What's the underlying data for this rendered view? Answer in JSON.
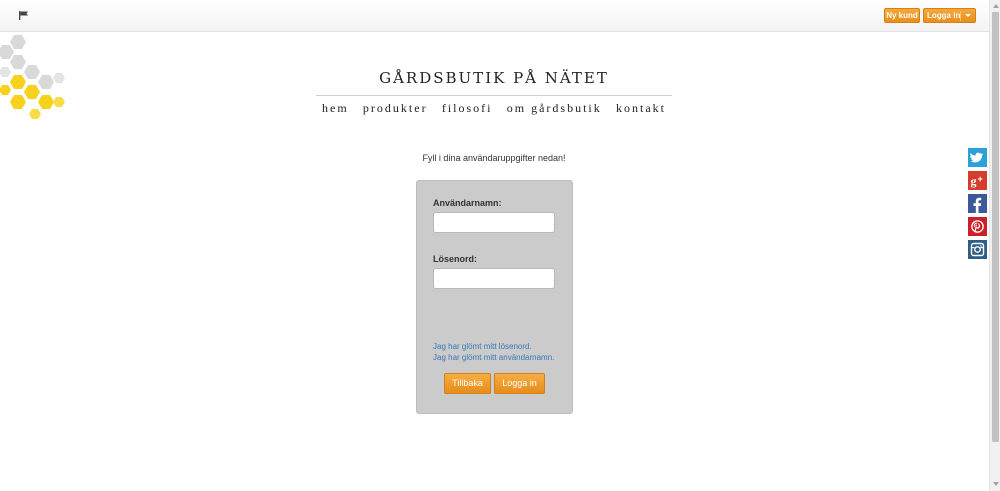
{
  "topbar": {
    "new_customer_label": "Ny kund",
    "login_label": "Logga in"
  },
  "site": {
    "title": "GÅRDSBUTIK PÅ NÄTET"
  },
  "nav": {
    "items": [
      {
        "label": "hem"
      },
      {
        "label": "produkter"
      },
      {
        "label": "filosofi"
      },
      {
        "label": "om gårdsbutik"
      },
      {
        "label": "kontakt"
      }
    ]
  },
  "login": {
    "intro": "Fyll i dina användaruppgifter nedan!",
    "username_label": "Användarnamn:",
    "username_value": "",
    "password_label": "Lösenord:",
    "password_value": "",
    "forgot_password": "Jag har glömt mitt lösenord.",
    "forgot_username": "Jag har glömt mitt användarnamn.",
    "back_button": "Tillbaka",
    "login_button": "Logga in"
  },
  "social": [
    {
      "icon": "twitter-icon",
      "color": "#2d9fd9"
    },
    {
      "icon": "google-plus-icon",
      "color": "#d23e2b"
    },
    {
      "icon": "facebook-icon",
      "color": "#3b5998"
    },
    {
      "icon": "pinterest-icon",
      "color": "#cb2027"
    },
    {
      "icon": "instagram-icon",
      "color": "#2e5e86"
    }
  ],
  "colors": {
    "accent_orange": "#f0a030",
    "link_blue": "#3a78b5",
    "login_box": "#cbcbcb"
  }
}
